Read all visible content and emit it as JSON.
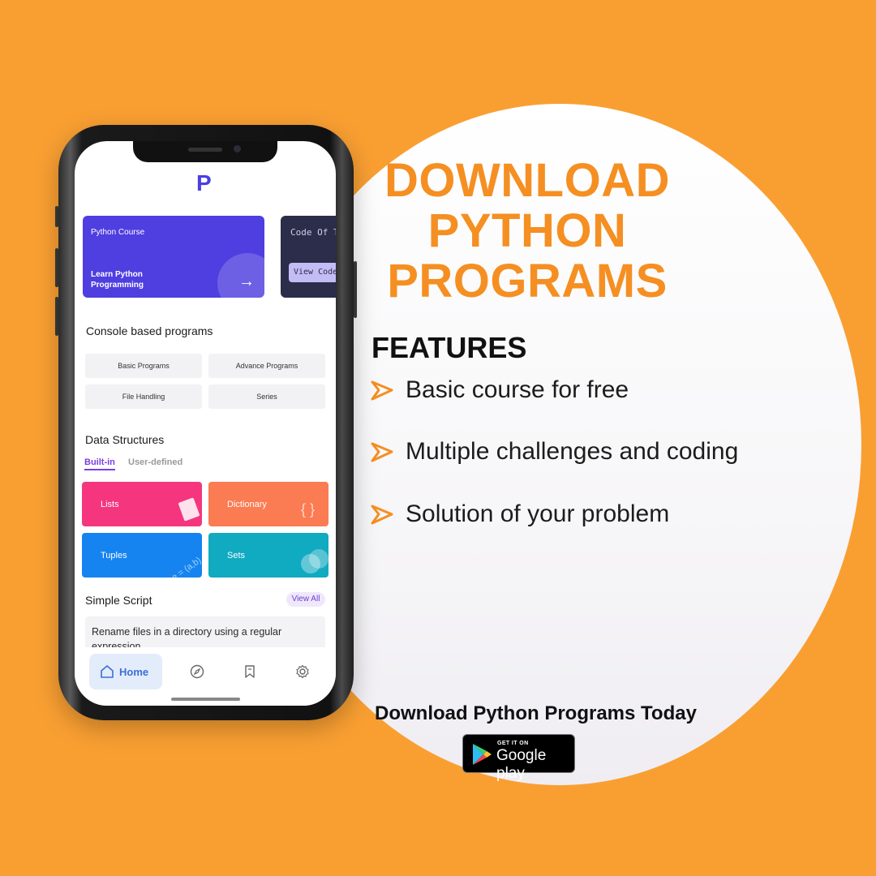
{
  "promo": {
    "headline_lines": [
      "DOWNLOAD",
      "PYTHON",
      "PROGRAMS"
    ],
    "features_title": "FEATURES",
    "features": [
      "Basic course for free",
      "Multiple challenges and coding",
      "Solution of your problem"
    ],
    "cta": "Download Python Programs Today",
    "store_badge": {
      "small": "GET IT ON",
      "big": "Google play"
    },
    "colors": {
      "background": "#f99f32",
      "accent": "#f58f22"
    }
  },
  "app": {
    "logo": "P",
    "course_card": {
      "subtitle": "Python Course",
      "title": "Learn Python Programming",
      "arrow": "→"
    },
    "code_card": {
      "title": "Code Of T",
      "button": "View Code"
    },
    "console_section": {
      "title": "Console based programs",
      "items": [
        "Basic Programs",
        "Advance Programs",
        "File Handling",
        "Series"
      ]
    },
    "data_structures": {
      "title": "Data Structures",
      "tabs": [
        "Built-in",
        "User-defined"
      ],
      "tiles": [
        {
          "label": "Lists",
          "color": "#f5367e"
        },
        {
          "label": "Dictionary",
          "color": "#fb7b52"
        },
        {
          "label": "Tuples",
          "color": "#1584f1"
        },
        {
          "label": "Sets",
          "color": "#10aac1"
        }
      ]
    },
    "simple_script": {
      "title": "Simple Script",
      "view_all": "View All",
      "first_item": "Rename files in a directory using a regular expression"
    },
    "nav": {
      "home": "Home",
      "icons": [
        "home-icon",
        "compass-icon",
        "bookmark-icon",
        "gear-icon"
      ]
    }
  }
}
